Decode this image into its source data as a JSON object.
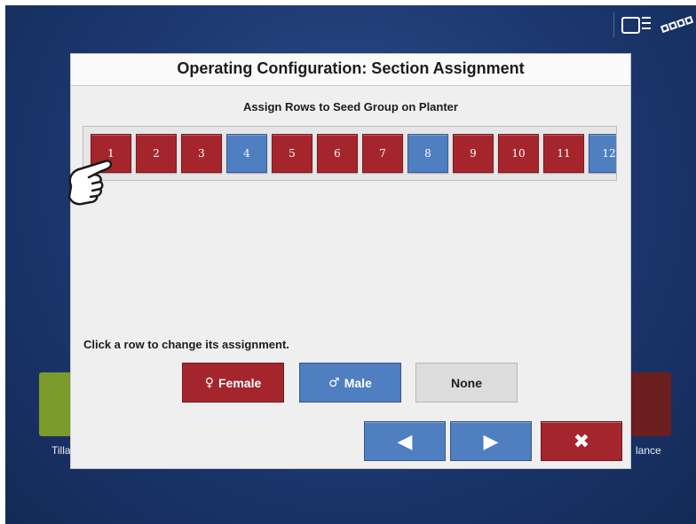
{
  "dialog": {
    "title": "Operating Configuration: Section Assignment",
    "subtitle": "Assign Rows to Seed Group on Planter",
    "hint": "Click a row to change its assignment."
  },
  "rows": [
    {
      "label": "1",
      "group": "female"
    },
    {
      "label": "2",
      "group": "female"
    },
    {
      "label": "3",
      "group": "female"
    },
    {
      "label": "4",
      "group": "male"
    },
    {
      "label": "5",
      "group": "female"
    },
    {
      "label": "6",
      "group": "female"
    },
    {
      "label": "7",
      "group": "female"
    },
    {
      "label": "8",
      "group": "male"
    },
    {
      "label": "9",
      "group": "female"
    },
    {
      "label": "10",
      "group": "female"
    },
    {
      "label": "11",
      "group": "female"
    },
    {
      "label": "12",
      "group": "male"
    }
  ],
  "assign_buttons": {
    "female_symbol": "♀",
    "female_label": "Female",
    "male_symbol": "♂",
    "male_label": "Male",
    "none_label": "None"
  },
  "nav": {
    "prev_icon": "◀",
    "next_icon": "▶",
    "close_icon": "✖"
  },
  "background_apps": {
    "left_label": "Tilla",
    "right_label": "lance"
  },
  "colors": {
    "female": "#a4262c",
    "male": "#4f7ec1",
    "none": "#dcdcdc"
  }
}
